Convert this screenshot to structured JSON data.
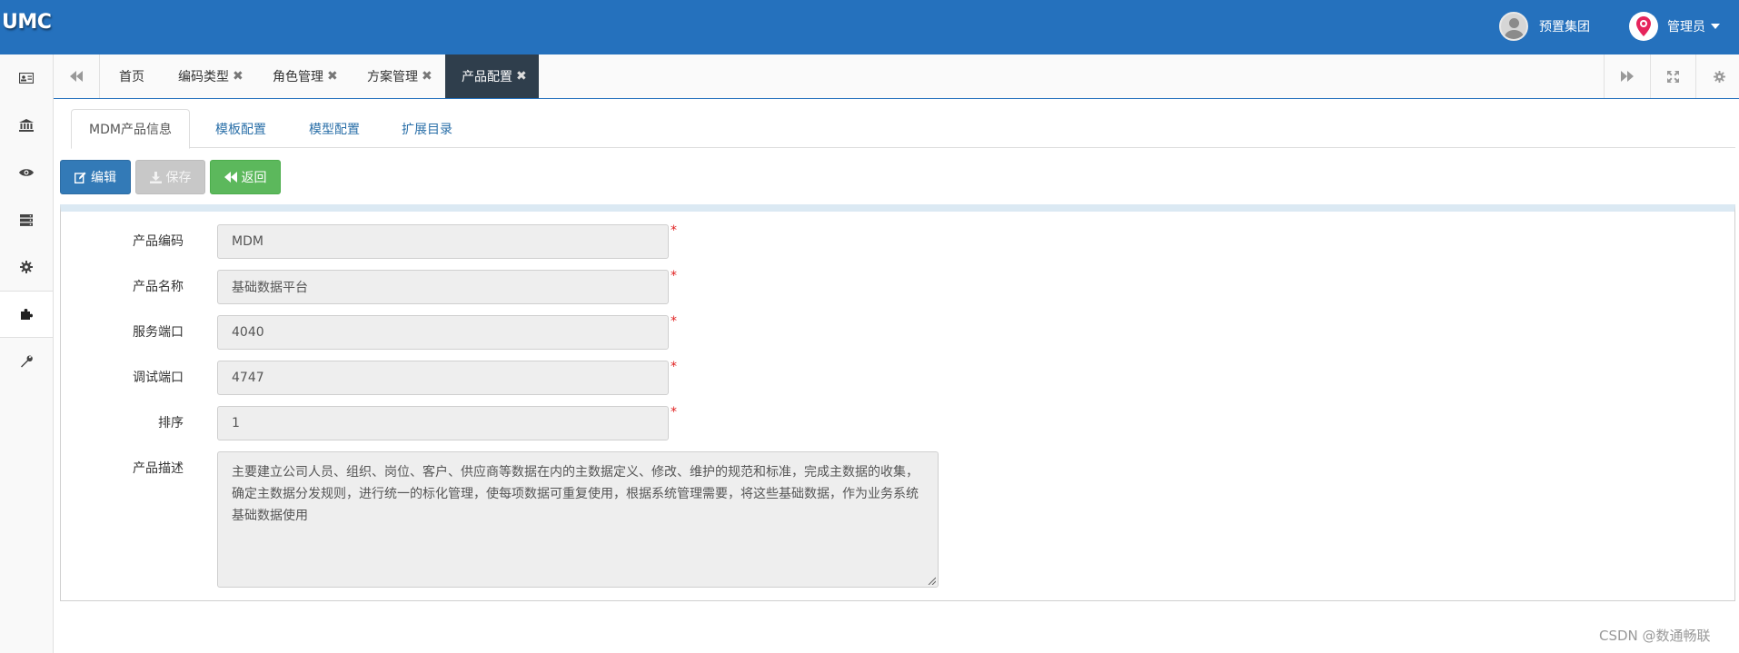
{
  "header": {
    "logo": "UMC",
    "org_name": "预置集团",
    "user_name": "管理员"
  },
  "sidebar": {
    "items": [
      {
        "icon": "id-card-icon"
      },
      {
        "icon": "bank-icon"
      },
      {
        "icon": "eye-icon"
      },
      {
        "icon": "server-icon"
      },
      {
        "icon": "gear-icon"
      },
      {
        "icon": "puzzle-icon",
        "active": true
      },
      {
        "icon": "wrench-icon"
      }
    ]
  },
  "tabbar": {
    "tabs": [
      {
        "label": "首页",
        "closable": false
      },
      {
        "label": "编码类型",
        "closable": true
      },
      {
        "label": "角色管理",
        "closable": true
      },
      {
        "label": "方案管理",
        "closable": true
      },
      {
        "label": "产品配置",
        "closable": true,
        "active": true
      }
    ],
    "close_glyph": "✖"
  },
  "subtabs": [
    {
      "label": "MDM产品信息",
      "active": true
    },
    {
      "label": "模板配置"
    },
    {
      "label": "模型配置"
    },
    {
      "label": "扩展目录"
    }
  ],
  "toolbar": {
    "edit_label": "编辑",
    "save_label": "保存",
    "back_label": "返回"
  },
  "form": {
    "product_code_label": "产品编码",
    "product_code_value": "MDM",
    "product_name_label": "产品名称",
    "product_name_value": "基础数据平台",
    "service_port_label": "服务端口",
    "service_port_value": "4040",
    "debug_port_label": "调试端口",
    "debug_port_value": "4747",
    "sort_label": "排序",
    "sort_value": "1",
    "desc_label": "产品描述",
    "desc_value": "主要建立公司人员、组织、岗位、客户、供应商等数据在内的主数据定义、修改、维护的规范和标准，完成主数据的收集，确定主数据分发规则，进行统一的标化管理，使每项数据可重复使用，根据系统管理需要，将这些基础数据，作为业务系统基础数据使用",
    "required_mark": "*"
  },
  "watermark": "CSDN @数通畅联",
  "colors": {
    "header_bg": "#2571bd",
    "active_tab_bg": "#2f3e4c",
    "edit_btn": "#337ab7",
    "back_btn": "#5cb85c",
    "save_btn_disabled": "#c8c8c8",
    "required": "#e02020"
  }
}
